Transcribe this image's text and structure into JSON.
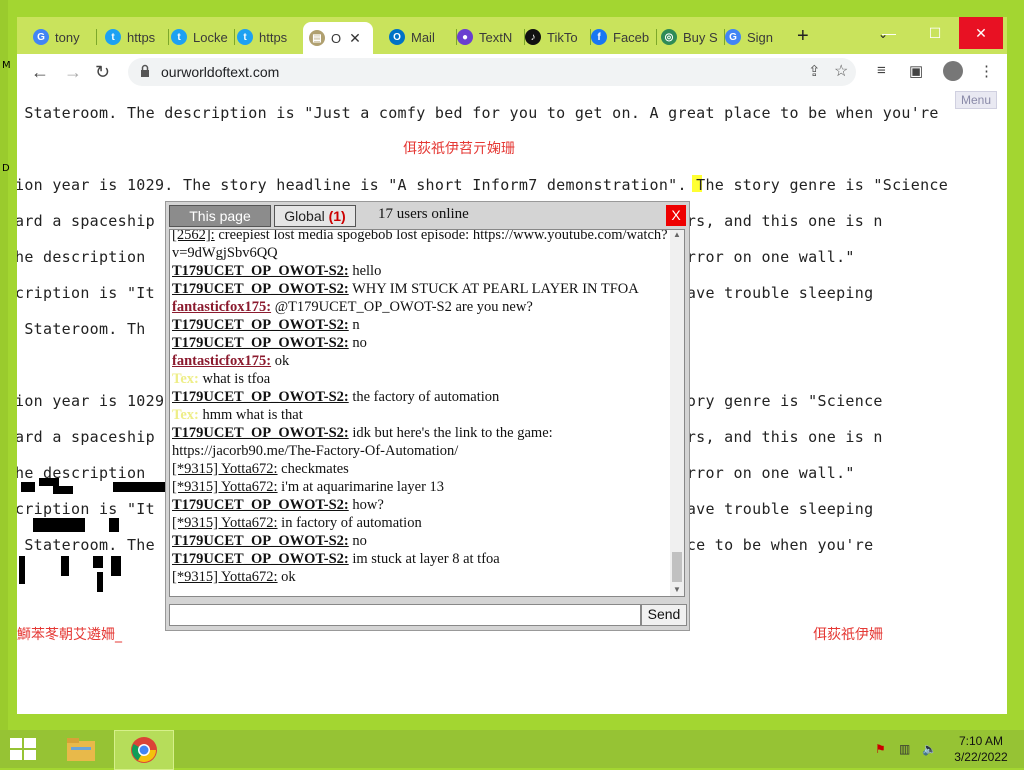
{
  "tabs": [
    {
      "label": "tony",
      "icon": "google-icon",
      "color": "#4285f4",
      "glyph": "G"
    },
    {
      "label": "https",
      "icon": "twitter-icon",
      "color": "#1da1f2",
      "glyph": "t"
    },
    {
      "label": "Locke",
      "icon": "twitter-icon",
      "color": "#1da1f2",
      "glyph": "t"
    },
    {
      "label": "https",
      "icon": "twitter-icon",
      "color": "#1da1f2",
      "glyph": "t"
    },
    {
      "label": "O",
      "icon": "ourworldoftext-icon",
      "color": "#b0a070",
      "glyph": "▤"
    },
    {
      "label": "Mail",
      "icon": "outlook-icon",
      "color": "#0072c6",
      "glyph": "O"
    },
    {
      "label": "TextN",
      "icon": "textnow-icon",
      "color": "#6a3fd0",
      "glyph": "●"
    },
    {
      "label": "TikTo",
      "icon": "tiktok-icon",
      "color": "#111111",
      "glyph": "♪"
    },
    {
      "label": "Faceb",
      "icon": "facebook-icon",
      "color": "#1877f2",
      "glyph": "f"
    },
    {
      "label": "Buy S",
      "icon": "shop-icon",
      "color": "#2e8b57",
      "glyph": "◎"
    },
    {
      "label": "Sign",
      "icon": "google-icon",
      "color": "#4285f4",
      "glyph": "G"
    }
  ],
  "browser": {
    "url": "ourworldoftext.com",
    "new_tab": "+",
    "tab_menu": "⌄",
    "minimize": "—",
    "maximize": "☐",
    "close": "✕"
  },
  "page": {
    "menu_label": "Menu",
    "lines": [
      " Stateroom. The description is \"Just a comfy bed for you to get on. A great place to be when you're",
      "ion year is 1029. The story headline is \"A short Inform7 demonstration\". The story genre is \"Science",
      "ard a spaceship                                              amped affairs, and this one is n",
      "he description                                               ere is a mirror on one wall.\"",
      "cription is \"It                                              hould you have trouble sleeping",
      " Stateroom. Th",
      "ion year is 1029                                             on\". The story genre is \"Science",
      "ard a spaceship                                              amped affairs, and this one is n",
      "he description                                               ere is a mirror on one wall.\"",
      "cription is \"It                                              hould you have trouble sleeping",
      " Stateroom. The                                              A great place to be when you're"
    ],
    "red_texts": [
      "佴荻祇伊苕亓婅珊",
      "鰤苯苳朝艾遴姍_",
      "佴荻祇伊姍"
    ]
  },
  "chat": {
    "tab_this": "This page",
    "tab_global": "Global",
    "global_count": "(1)",
    "online": "17 users online",
    "close": "X",
    "send": "Send",
    "messages": [
      {
        "nick": "[2562]:",
        "style": "plain",
        "text": " creepiest lost media spogebob lost episode: https://www.youtube.com/watch?v=9dWgjSbv6QQ"
      },
      {
        "nick": "T179UCET_OP_OWOT-S2:",
        "style": "black",
        "text": " hello"
      },
      {
        "nick": "T179UCET_OP_OWOT-S2:",
        "style": "black",
        "text": " WHY IM STUCK AT PEARL LAYER IN TFOA"
      },
      {
        "nick": "fantasticfox175:",
        "style": "maroon",
        "text": " @T179UCET_OP_OWOT-S2 are you new?"
      },
      {
        "nick": "T179UCET_OP_OWOT-S2:",
        "style": "black",
        "text": " n"
      },
      {
        "nick": "T179UCET_OP_OWOT-S2:",
        "style": "black",
        "text": " no"
      },
      {
        "nick": "fantasticfox175:",
        "style": "maroon",
        "text": " ok"
      },
      {
        "nick": "Tex:",
        "style": "yellow",
        "text": " what is tfoa"
      },
      {
        "nick": "T179UCET_OP_OWOT-S2:",
        "style": "black",
        "text": " the factory of automation"
      },
      {
        "nick": "Tex:",
        "style": "yellow",
        "text": " hmm what is that"
      },
      {
        "nick": "T179UCET_OP_OWOT-S2:",
        "style": "black",
        "text": " idk but here's the link to the game: https://jacorb90.me/The-Factory-Of-Automation/"
      },
      {
        "nick": "[*9315] Yotta672:",
        "style": "plain",
        "text": " checkmates"
      },
      {
        "nick": "[*9315] Yotta672:",
        "style": "plain",
        "text": " i'm at aquarimarine layer 13"
      },
      {
        "nick": "T179UCET_OP_OWOT-S2:",
        "style": "black",
        "text": " how?"
      },
      {
        "nick": "[*9315] Yotta672:",
        "style": "plain",
        "text": " in factory of automation"
      },
      {
        "nick": "T179UCET_OP_OWOT-S2:",
        "style": "black",
        "text": " no"
      },
      {
        "nick": "T179UCET_OP_OWOT-S2:",
        "style": "black",
        "text": " im stuck at layer 8 at tfoa"
      },
      {
        "nick": "[*9315] Yotta672:",
        "style": "plain",
        "text": " ok"
      }
    ]
  },
  "taskbar": {
    "time": "7:10 AM",
    "date": "3/22/2022"
  },
  "desktop": {
    "labels": [
      "M",
      "D"
    ]
  },
  "colors": {
    "taskbar": "#96c334",
    "browser_frame": "#c9e35c",
    "chat_close": "#ee0000",
    "red_text": "#e53935"
  }
}
